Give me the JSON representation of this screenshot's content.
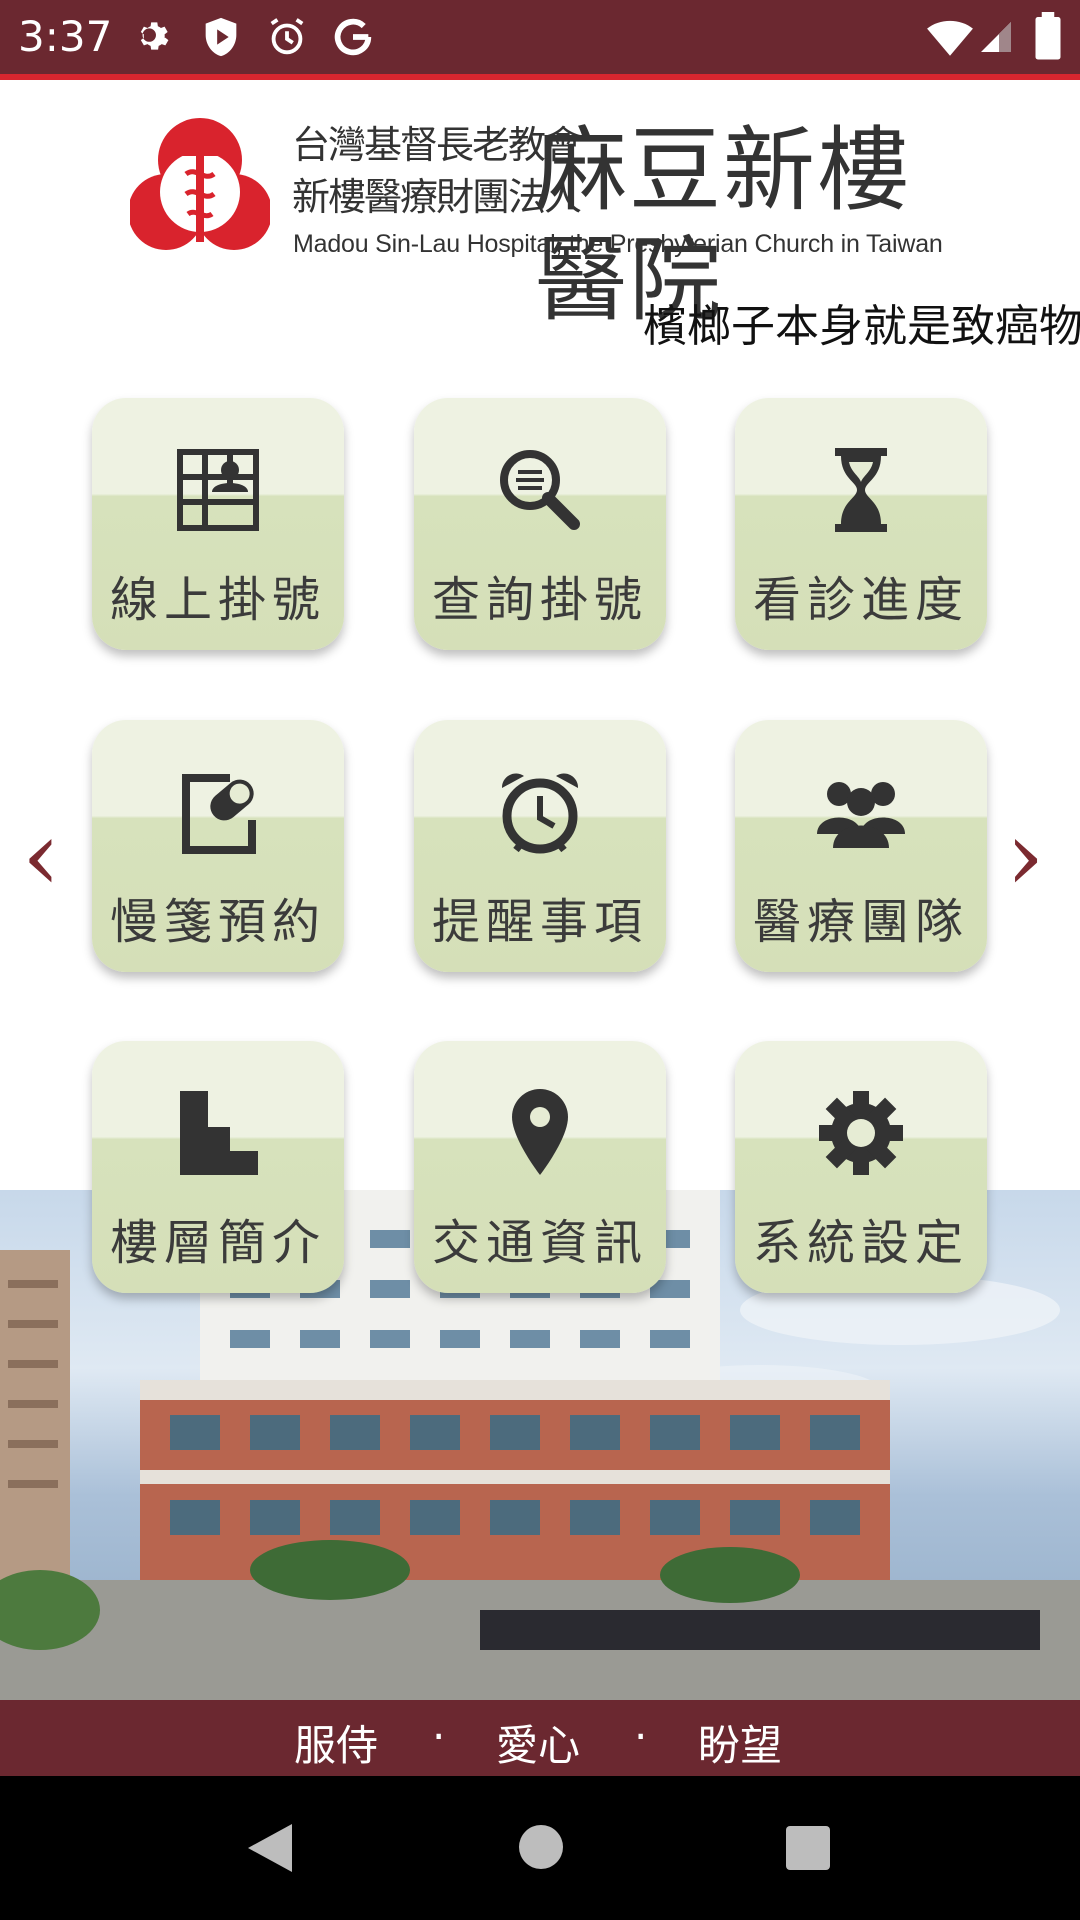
{
  "status_bar": {
    "time": "3:37",
    "icons_left": [
      "gear-icon",
      "shield-icon",
      "alarm-icon",
      "google-g-icon"
    ],
    "icons_right": [
      "wifi-icon",
      "signal-icon",
      "battery-icon"
    ]
  },
  "header": {
    "line1": "台灣基督長老教會",
    "line2": "新樓醫療財團法人",
    "name": "麻豆新樓醫院",
    "english": "Madou Sin-Lau Hospital, the Presbyterian Church in Taiwan"
  },
  "marquee": {
    "text": "檳榔子本身就是致癌物"
  },
  "grid": {
    "tiles": [
      {
        "label": "線上掛號",
        "icon": "registration-icon"
      },
      {
        "label": "查詢掛號",
        "icon": "search-icon"
      },
      {
        "label": "看診進度",
        "icon": "hourglass-icon"
      },
      {
        "label": "慢箋預約",
        "icon": "prescription-icon"
      },
      {
        "label": "提醒事項",
        "icon": "alarm-clock-icon"
      },
      {
        "label": "醫療團隊",
        "icon": "team-icon"
      },
      {
        "label": "樓層簡介",
        "icon": "floors-icon"
      },
      {
        "label": "交通資訊",
        "icon": "location-pin-icon"
      },
      {
        "label": "系統設定",
        "icon": "settings-gear-icon"
      }
    ],
    "prev_arrow": "‹",
    "next_arrow": "›"
  },
  "footer": {
    "word1": "服侍",
    "sep1": "·",
    "word2": "愛心",
    "sep2": "·",
    "word3": "盼望"
  },
  "nav": {
    "buttons": [
      "back-icon",
      "home-icon",
      "recents-icon"
    ]
  },
  "colors": {
    "brand": "#6b2830",
    "accent_line": "#d8262f",
    "tile_top": "#eef2e2",
    "tile_bottom": "#d5dfb8",
    "icon": "#333333"
  }
}
